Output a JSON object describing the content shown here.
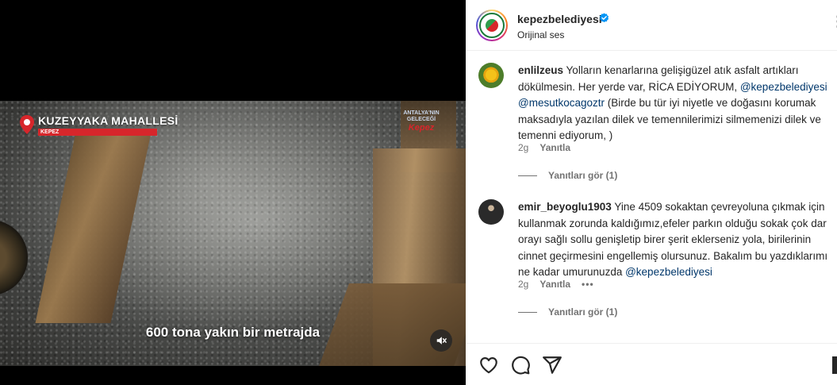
{
  "video": {
    "location_title": "KUZEYYAKA MAHALLESİ",
    "location_sub": "KEPEZ",
    "logo_line1": "ANTALYA'NIN",
    "logo_line2": "GELECEĞİ",
    "logo_signature": "Kepez",
    "subtitle": "600 tona yakın bir metrajda",
    "mute_icon": "speaker-muted-icon"
  },
  "header": {
    "username": "kepezbelediyesi",
    "audio": "Orijinal ses",
    "verified_color": "#0095f6"
  },
  "comments": [
    {
      "username": "enlilzeus",
      "text_1": "Yolların kenarlarına gelişigüzel atık asfalt artıkları dökülmesin. Her yerde var, RİCA EDİYORUM, ",
      "mention_1": "@kepezbelediyesi",
      "mention_2": "@mesutkocagoztr",
      "text_2": " (Birde bu tür iyi niyetle ve doğasını korumak maksadıyla yazılan dilek ve temennilerimizi silmemenizi dilek ve temenni ediyorum, )",
      "time": "2g",
      "reply_label": "Yanıtla",
      "view_replies": "Yanıtları gör (1)"
    },
    {
      "username": "emir_beyoglu1903",
      "text_1": "Yine 4509 sokaktan çevreyoluna çıkmak için kullanmak zorunda kaldığımız,efeler parkın olduğu sokak çok dar orayı sağlı sollu genişletip birer şerit eklerseniz yola, birilerinin cinnet geçirmesini engellemiş olursunuz. Bakalım bu yazdıklarımı ne kadar umurunuzda ",
      "mention_1": "@kepezbelediyesi",
      "time": "2g",
      "reply_label": "Yanıtla",
      "more": "•••",
      "view_replies": "Yanıtları gör (1)"
    }
  ],
  "actions": {
    "like_icon": "heart-icon",
    "comment_icon": "comment-icon",
    "share_icon": "share-icon",
    "save_icon": "bookmark-icon"
  }
}
